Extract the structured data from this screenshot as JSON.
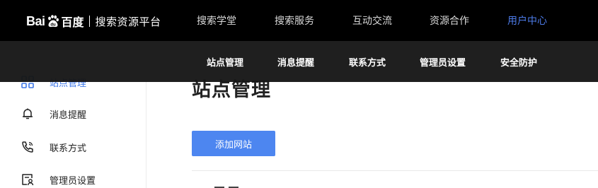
{
  "brand": {
    "logo_latin_left": "Bai",
    "logo_latin_right": "",
    "logo_chinese": "百度",
    "platform": "搜索资源平台"
  },
  "topnav": [
    {
      "label": "搜索学堂"
    },
    {
      "label": "搜索服务"
    },
    {
      "label": "互动交流"
    },
    {
      "label": "资源合作"
    },
    {
      "label": "用户中心",
      "active": true
    }
  ],
  "submenu": [
    {
      "label": "站点管理"
    },
    {
      "label": "消息提醒"
    },
    {
      "label": "联系方式"
    },
    {
      "label": "管理员设置"
    },
    {
      "label": "安全防护"
    }
  ],
  "sidebar": {
    "items": [
      {
        "label": "站点管理",
        "icon": "grid-icon",
        "active": true
      },
      {
        "label": "消息提醒",
        "icon": "bell-icon"
      },
      {
        "label": "联系方式",
        "icon": "phone-icon"
      },
      {
        "label": "管理员设置",
        "icon": "admin-card-icon"
      }
    ]
  },
  "main": {
    "title": "站点管理",
    "add_button": "添加网站"
  },
  "colors": {
    "accent": "#4d86f0",
    "active_nav": "#4d7be8",
    "topbar_bg": "#000000",
    "submenu_bg": "#161616"
  }
}
